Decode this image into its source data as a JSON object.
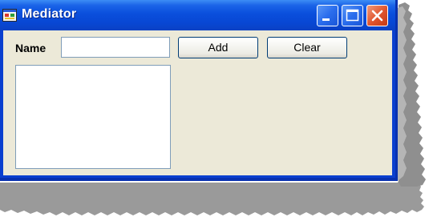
{
  "window": {
    "title": "Mediator",
    "controls": {
      "minimize_icon": "minimize-icon",
      "maximize_icon": "maximize-icon",
      "close_icon": "close-icon"
    }
  },
  "form": {
    "name_label": "Name",
    "name_value": "",
    "add_label": "Add",
    "clear_label": "Clear",
    "list_items": []
  },
  "colors": {
    "titlebar_blue": "#0a4fdc",
    "client_background": "#ece9d8",
    "close_red": "#e0532b"
  }
}
